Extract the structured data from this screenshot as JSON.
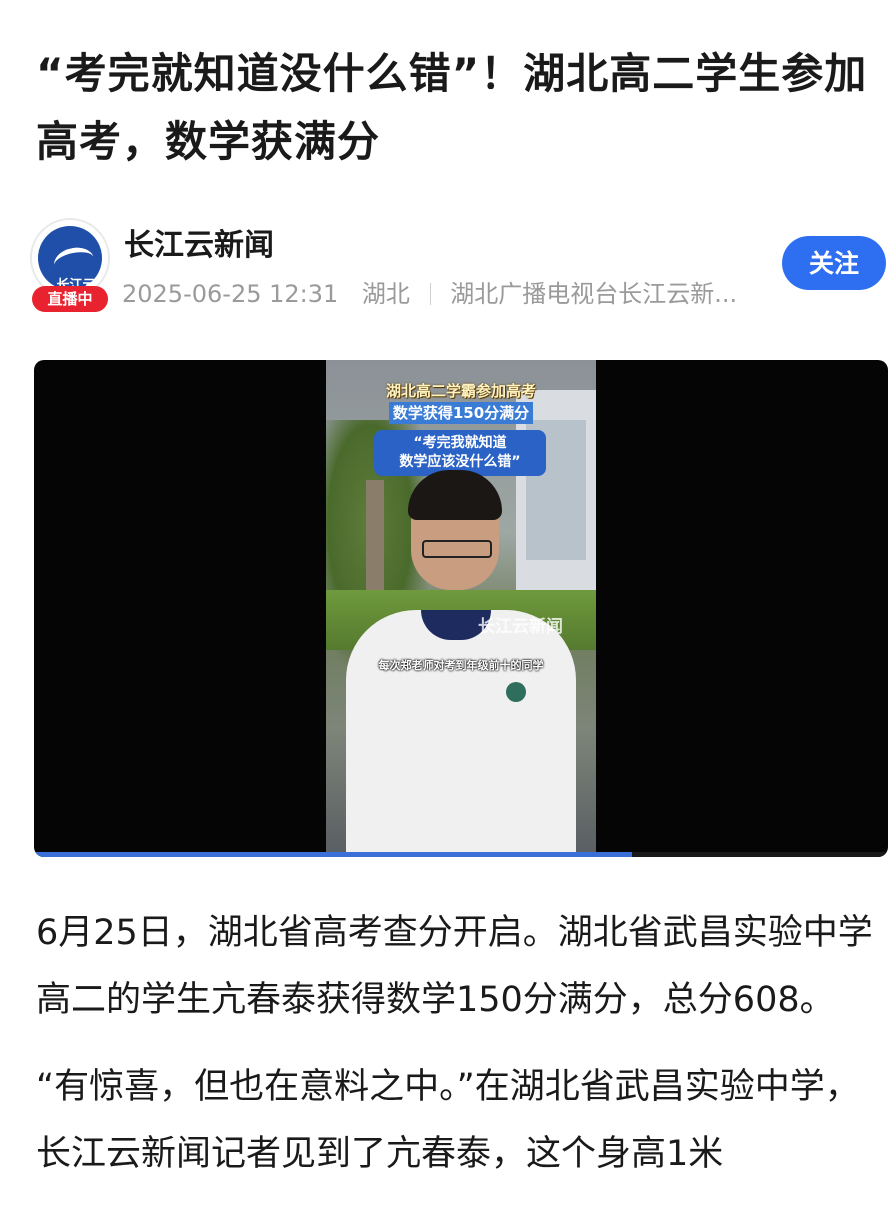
{
  "article": {
    "title": "“考完就知道没什么错”！湖北高二学生参加高考，数学获满分"
  },
  "author": {
    "name": "长江云新闻",
    "avatar_label": "长江云",
    "live_badge": "直播中",
    "datetime": "2025-06-25 12:31",
    "location": "湖北",
    "source": "湖北广播电视台长江云新...",
    "follow_label": "关注"
  },
  "video": {
    "caption_line1": "湖北高二学霸参加高考",
    "caption_line2": "数学获得150分满分",
    "quote_line1": "“考完我就知道",
    "quote_line2": "数学应该没什么错”",
    "subtitle": "每次郑老师对考到年级前十的同学",
    "watermark": "长江云新闻",
    "progress": 0.7
  },
  "body": {
    "paragraph1": "6月25日，湖北省高考查分开启。湖北省武昌实验中学高二的学生亢春泰获得数学150分满分，总分608。",
    "paragraph2": "“有惊喜，但也在意料之中。”在湖北省武昌实验中学，长江云新闻记者见到了亢春泰，这个身高1米"
  },
  "colors": {
    "accent": "#2e6ff2",
    "live_badge": "#e8232f",
    "meta_text": "#9a9a9a",
    "progress": "#3a6fd8"
  }
}
